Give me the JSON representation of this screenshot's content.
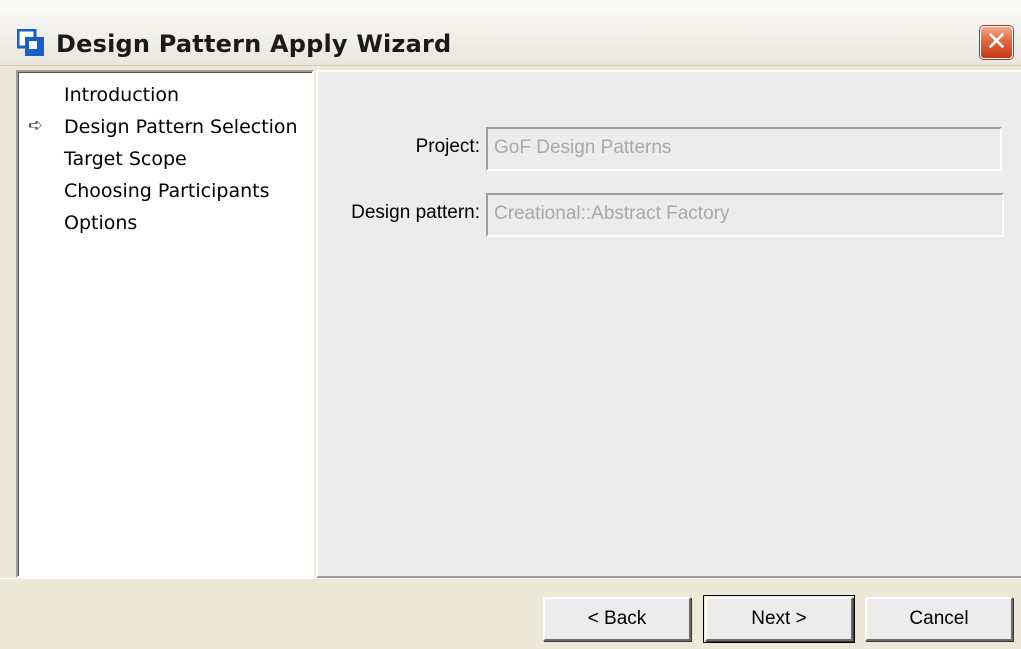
{
  "window": {
    "title": "Design Pattern Apply Wizard",
    "close_glyph": "✕",
    "icon": "wizard-app-icon",
    "accent_color": "#1561c9"
  },
  "steps": {
    "current_marker": "➪",
    "items": [
      {
        "label": "Introduction",
        "current": false
      },
      {
        "label": "Design Pattern Selection",
        "current": true
      },
      {
        "label": "Target Scope",
        "current": false
      },
      {
        "label": "Choosing Participants",
        "current": false
      },
      {
        "label": "Options",
        "current": false
      }
    ]
  },
  "form": {
    "project": {
      "label": "Project:",
      "value": "GoF Design Patterns"
    },
    "design_pattern": {
      "label": "Design pattern:",
      "value": "Creational::Abstract Factory"
    }
  },
  "buttons": {
    "back": "< Back",
    "next": "Next >",
    "cancel": "Cancel"
  }
}
